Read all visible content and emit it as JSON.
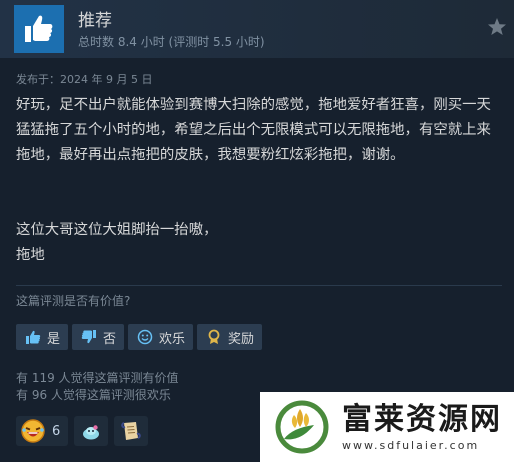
{
  "review": {
    "verdict": "推荐",
    "hours": "总时数 8.4 小时  (评测时 5.5 小时)",
    "posted": "发布于：2024 年 9 月 5 日",
    "body_p1": "好玩，足不出户就能体验到赛博大扫除的感觉，拖地爱好者狂喜，刚买一天猛猛拖了五个小时的地，希望之后出个无限模式可以无限拖地，有空就上来拖地，最好再出点拖把的皮肤，我想要粉红炫彩拖把，谢谢。",
    "body_p2_line1": "这位大哥这位大姐脚抬一抬嗷，",
    "body_p2_line2": "拖地"
  },
  "feedback": {
    "question": "这篇评测是否有价值?",
    "yes_label": "是",
    "no_label": "否",
    "funny_label": "欢乐",
    "award_label": "奖励"
  },
  "stats": {
    "helpful": "有 119 人觉得这篇评测有价值",
    "funny": "有 96 人觉得这篇评测很欢乐"
  },
  "awards": [
    {
      "icon": "laughing-face-award-icon",
      "count": "6"
    },
    {
      "icon": "slime-award-icon",
      "count": ""
    },
    {
      "icon": "scroll-award-icon",
      "count": ""
    }
  ],
  "watermark": {
    "name": "富莱资源网",
    "url": "www.sdfulaier.com"
  },
  "colors": {
    "background": "#16202d",
    "header": "#223246",
    "thumb_box": "#1c6fb0",
    "button": "#2c3d51",
    "text": "#d6d7d8",
    "muted": "#7b8895"
  }
}
